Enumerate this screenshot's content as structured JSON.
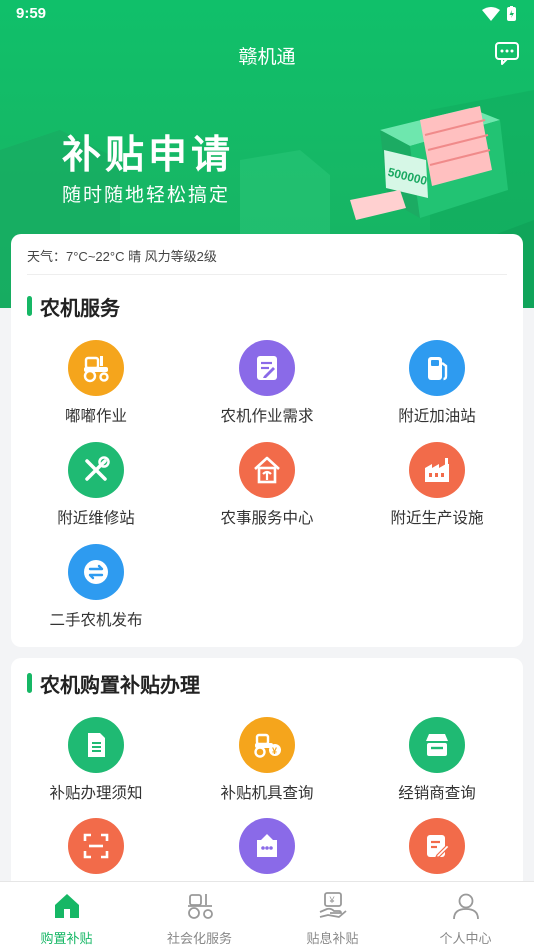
{
  "status_bar": {
    "time": "9:59"
  },
  "header": {
    "title": "赣机通",
    "message_icon": "chat-bubble-icon"
  },
  "banner": {
    "title": "补贴申请",
    "subtitle": "随时随地轻松搞定",
    "machine_text": "500000"
  },
  "weather": {
    "text": "天气：7°C~22°C 晴 风力等级2级"
  },
  "services": {
    "title": "农机服务",
    "items": [
      {
        "label": "嘟嘟作业",
        "icon": "tractor-icon",
        "color": "#f5a51c"
      },
      {
        "label": "农机作业需求",
        "icon": "edit-document-icon",
        "color": "#8a6ae8"
      },
      {
        "label": "附近加油站",
        "icon": "gas-station-icon",
        "color": "#2e9bf0"
      },
      {
        "label": "附近维修站",
        "icon": "tools-icon",
        "color": "#1fba73"
      },
      {
        "label": "农事服务中心",
        "icon": "service-center-icon",
        "color": "#f26b4a"
      },
      {
        "label": "附近生产设施",
        "icon": "factory-icon",
        "color": "#f26b4a"
      },
      {
        "label": "二手农机发布",
        "icon": "exchange-icon",
        "color": "#2e9bf0"
      }
    ]
  },
  "subsidy": {
    "title": "农机购置补贴办理",
    "items": [
      {
        "label": "补贴办理须知",
        "icon": "document-icon",
        "color": "#1fba73"
      },
      {
        "label": "补贴机具查询",
        "icon": "tractor-subsidy-icon",
        "color": "#f5a51c"
      },
      {
        "label": "经销商查询",
        "icon": "store-icon",
        "color": "#1fba73"
      },
      {
        "label": "",
        "icon": "scan-icon",
        "color": "#f26b4a"
      },
      {
        "label": "",
        "icon": "chat-box-icon",
        "color": "#8a6ae8"
      },
      {
        "label": "",
        "icon": "edit-note-icon",
        "color": "#f26b4a"
      }
    ]
  },
  "tabbar": {
    "active_color": "#16b765",
    "tabs": [
      {
        "label": "购置补贴",
        "icon": "home-icon",
        "active": true
      },
      {
        "label": "社会化服务",
        "icon": "tractor-outline-icon",
        "active": false
      },
      {
        "label": "贴息补贴",
        "icon": "money-hand-icon",
        "active": false
      },
      {
        "label": "个人中心",
        "icon": "person-icon",
        "active": false
      }
    ]
  }
}
